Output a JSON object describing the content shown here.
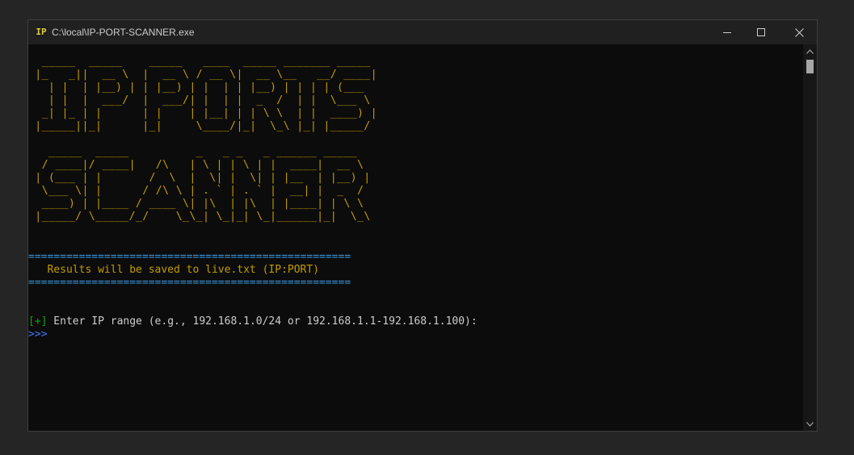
{
  "window": {
    "title": "C:\\local\\IP-PORT-SCANNER.exe",
    "icon_label": "IP"
  },
  "console": {
    "ascii_art": [
      "  _____  _____    _____   ____  _____ _______ _____ ",
      " |_   _||  __ \\  |  __ \\ / __ \\|  __ \\__   __/ ____|",
      "   | |  | |__) | | |__) | |  | | |__) | | | | (___  ",
      "   | |  |  ___/  |  ___/| |  | |  _  /  | |  \\___ \\ ",
      "  _| |_ | |      | |    | |__| | | \\ \\  | |  ____) |",
      " |_____||_|      |_|     \\____/|_|  \\_\\ |_| |_____/ ",
      "",
      "   _____  _____          _   _ _   _ ______ _____  ",
      "  / ____|/ ____|   /\\   | \\ | | \\ | |  ____|  __ \\ ",
      " | (___ | |       /  \\  |  \\| |  \\| | |__  | |__) |",
      "  \\___ \\| |      / /\\ \\ | . ` | . ` |  __| |  _  / ",
      "  ____) | |____ / ____ \\| |\\  | |\\  | |____| | \\ \\ ",
      " |_____/ \\_____/_/    \\_\\_| \\_|_| \\_|______|_|  \\_\\"
    ],
    "separator": "===================================================",
    "results_message": "   Results will be saved to live.txt (IP:PORT)",
    "prompt_marker": "[+]",
    "prompt_text": " Enter IP range (e.g., 192.168.1.0/24 or 192.168.1.1-192.168.1.100):",
    "input_prompt": ">>>"
  },
  "colors": {
    "ascii": "#c19c00",
    "separator": "#3a96dd",
    "marker": "#13a10e",
    "input_prompt": "#3b78ff",
    "background": "#0c0c0c"
  }
}
